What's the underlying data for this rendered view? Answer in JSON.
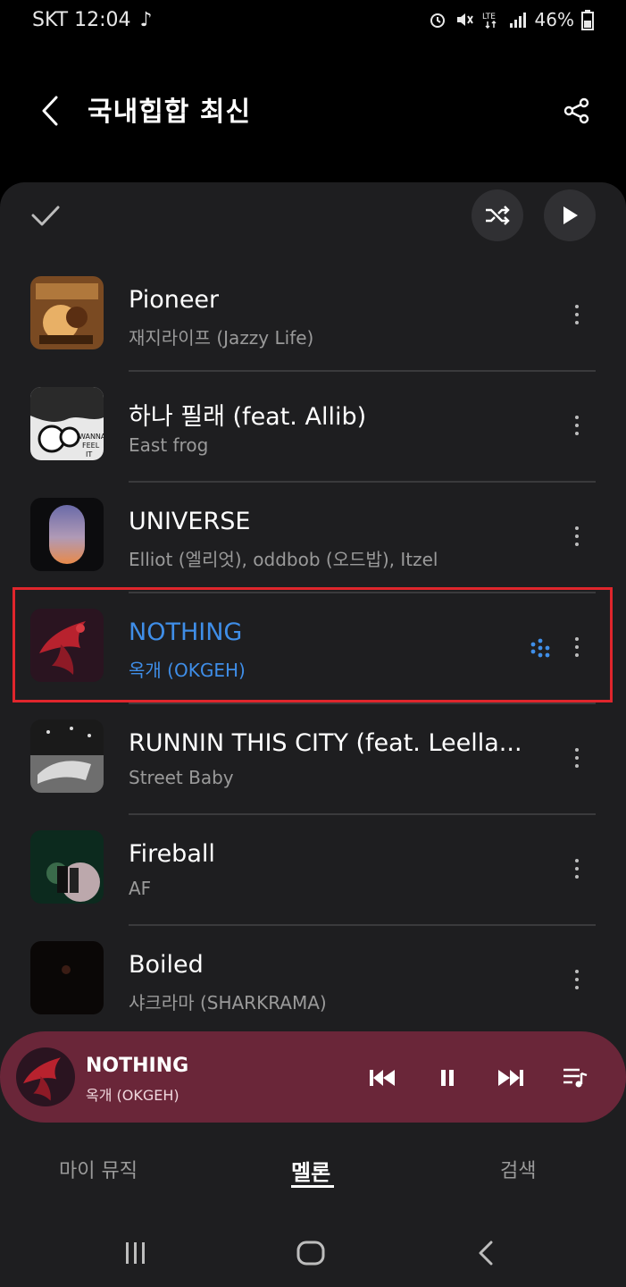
{
  "status_bar": {
    "carrier_time": "SKT 12:04",
    "battery": "46%"
  },
  "header": {
    "title": "국내힙합 최신"
  },
  "songs": [
    {
      "title": "Pioneer",
      "artist": "재지라이프 (Jazzy Life)",
      "playing": false
    },
    {
      "title": "하나 필래 (feat. Allib)",
      "artist": "East frog",
      "playing": false
    },
    {
      "title": "UNIVERSE",
      "artist": "Elliot (엘리엇), oddbob (오드밥), Itzel",
      "playing": false
    },
    {
      "title": "NOTHING",
      "artist": "옥개 (OKGEH)",
      "playing": true
    },
    {
      "title": "RUNNIN THIS CITY (feat. Leella...",
      "artist": "Street Baby",
      "playing": false
    },
    {
      "title": "Fireball",
      "artist": "AF",
      "playing": false
    },
    {
      "title": "Boiled",
      "artist": "샤크라마 (SHARKRAMA)",
      "playing": false
    }
  ],
  "mini_player": {
    "title": "NOTHING",
    "artist": "옥개 (OKGEH)",
    "background": "#6a2639"
  },
  "tabs": [
    {
      "label": "마이 뮤직",
      "active": false
    },
    {
      "label": "멜론",
      "active": true
    },
    {
      "label": "검색",
      "active": false
    }
  ],
  "colors": {
    "accent": "#3f8ee8",
    "highlight": "#e0262c",
    "panel": "#1e1e20"
  }
}
